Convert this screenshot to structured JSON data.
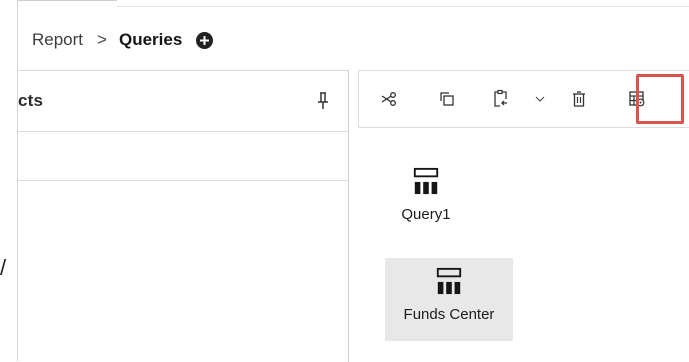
{
  "breadcrumb": {
    "items": [
      {
        "label": "Report"
      },
      {
        "label": "Queries"
      }
    ],
    "separator": ">"
  },
  "panel": {
    "title": "cts"
  },
  "toolbar": {
    "buttons": [
      {
        "icon": "cut-icon"
      },
      {
        "icon": "copy-icon"
      },
      {
        "icon": "paste-icon"
      },
      {
        "icon": "chevron-down-icon"
      },
      {
        "icon": "delete-icon"
      },
      {
        "icon": "query-properties-icon",
        "highlighted": true
      }
    ],
    "highlight_color": "#d9534f"
  },
  "queries": [
    {
      "label": "Query1",
      "selected": false
    },
    {
      "label": "Funds Center",
      "selected": true
    }
  ],
  "left_edge_mark": "/"
}
